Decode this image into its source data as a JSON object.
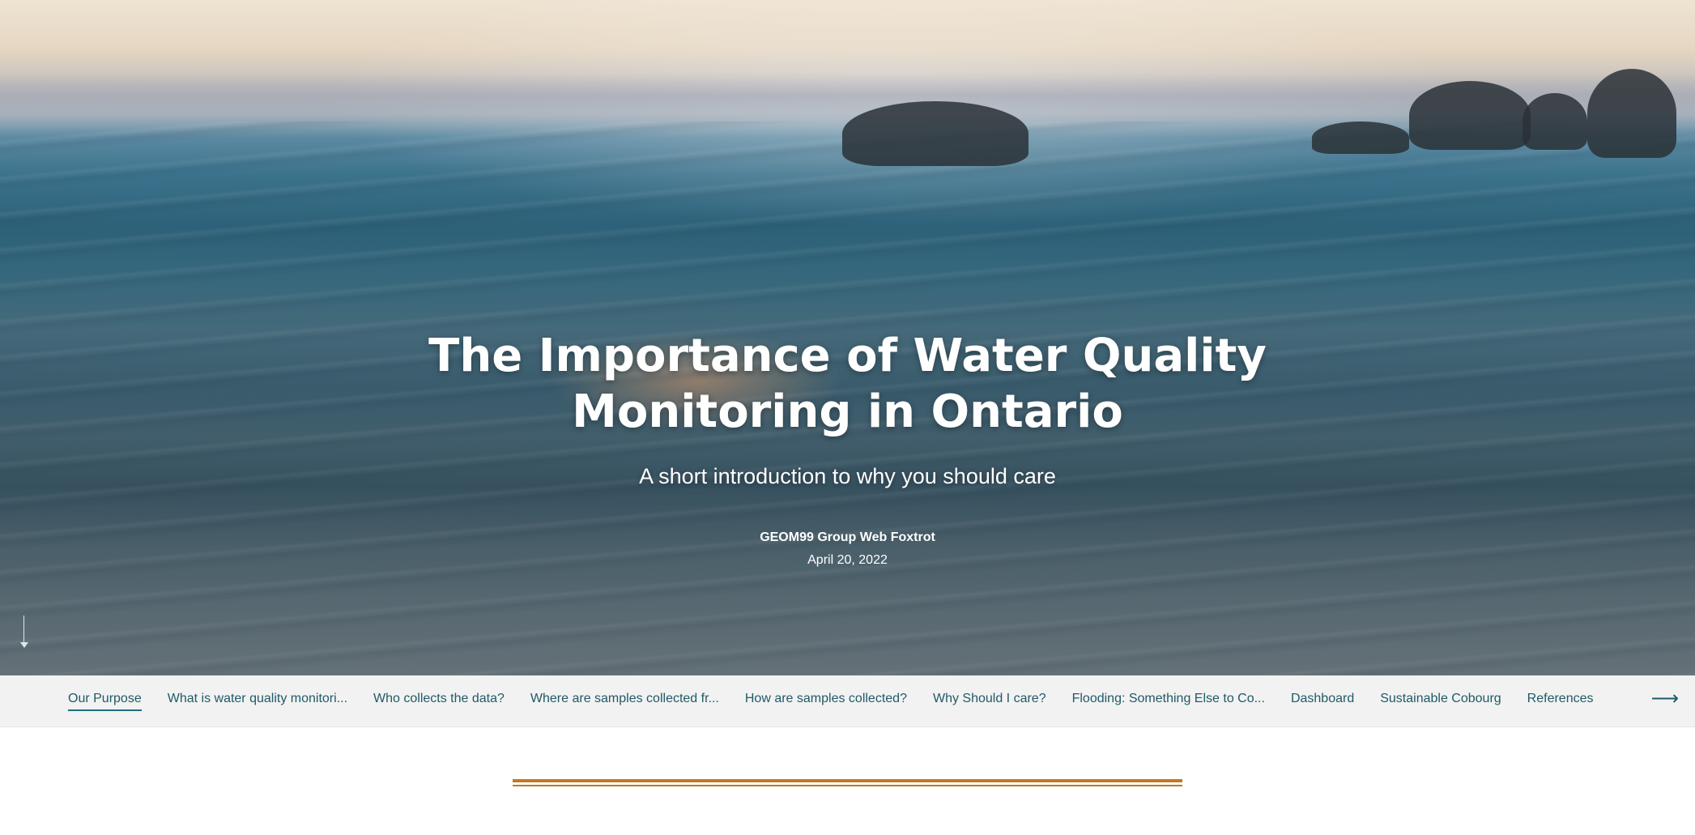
{
  "hero": {
    "title_line1": "The Importance of Water Quality",
    "title_line2": "Monitoring in Ontario",
    "subtitle": "A short introduction to why you should care",
    "author": "GEOM99 Group Web Foxtrot",
    "date": "April 20, 2022",
    "scroll_icon": "arrow-down-icon"
  },
  "nav": {
    "items": [
      {
        "label": "Our Purpose",
        "active": true
      },
      {
        "label": "What is water quality monitori...",
        "active": false
      },
      {
        "label": "Who collects the data?",
        "active": false
      },
      {
        "label": "Where are samples collected fr...",
        "active": false
      },
      {
        "label": "How are samples collected?",
        "active": false
      },
      {
        "label": "Why Should I care?",
        "active": false
      },
      {
        "label": "Flooding: Something Else to Co...",
        "active": false
      },
      {
        "label": "Dashboard",
        "active": false
      },
      {
        "label": "Sustainable Cobourg",
        "active": false
      },
      {
        "label": "References",
        "active": false
      }
    ],
    "next_icon": "arrow-right-icon",
    "next_glyph": "⟶"
  },
  "colors": {
    "nav_text": "#1f5a66",
    "accent_rule": "#c07a22",
    "nav_background": "#f2f2f2"
  }
}
